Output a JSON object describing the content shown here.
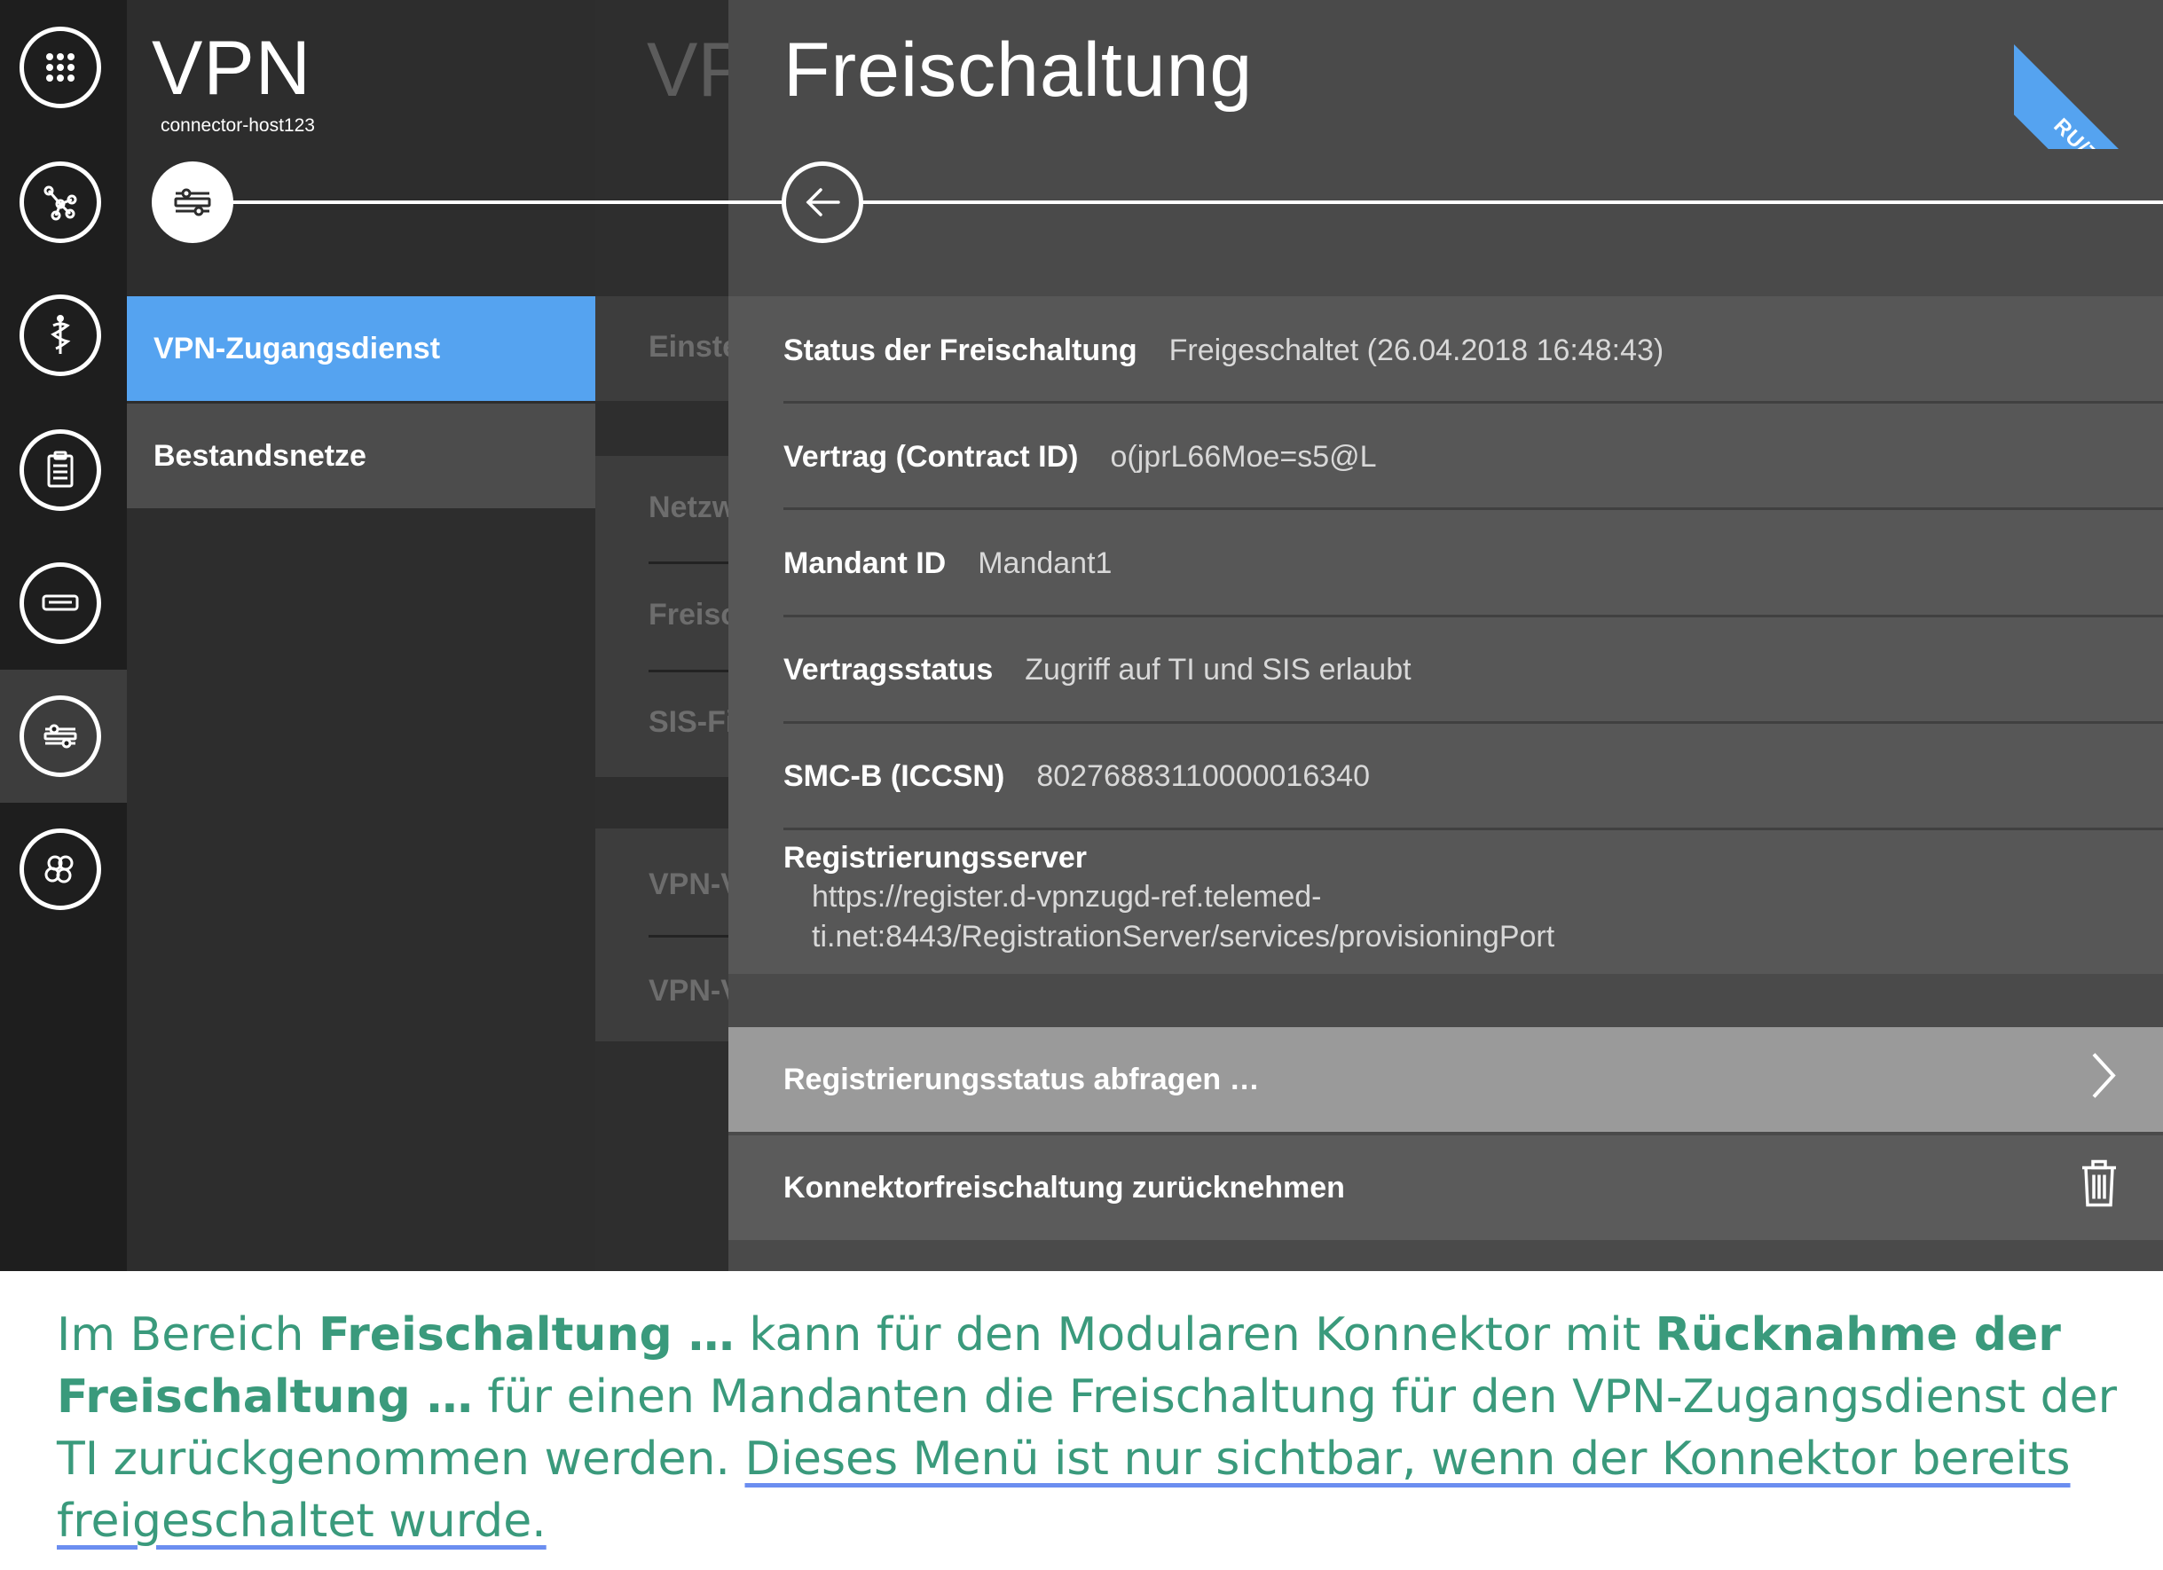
{
  "rail": {
    "icons": [
      "apps-grid-icon",
      "network-graph-icon",
      "medical-caduceus-icon",
      "clipboard-icon",
      "device-card-terminal-icon",
      "vpn-switch-icon",
      "modules-hexagon-icon"
    ],
    "active_index": 5
  },
  "vpn_menu": {
    "title": "VPN",
    "host": "connector-host123",
    "items": [
      {
        "label": "VPN-Zugangsdienst",
        "active": true
      },
      {
        "label": "Bestandsnetze",
        "active": false
      }
    ]
  },
  "background_column": {
    "title": "VP",
    "items": [
      "Einste",
      "Netzw",
      "Freisc",
      "SIS-Fi",
      "VPN-V",
      "VPN-V"
    ]
  },
  "freischaltung": {
    "title": "Freischaltung",
    "corner_badge": "RU/TU",
    "fields": [
      {
        "label": "Status der Freischaltung",
        "value": "Freigeschaltet (26.04.2018 16:48:43)"
      },
      {
        "label": "Vertrag (Contract ID)",
        "value": "o(jprL66Moe=s5@L"
      },
      {
        "label": "Mandant ID",
        "value": "Mandant1"
      },
      {
        "label": "Vertragsstatus",
        "value": "Zugriff auf TI und SIS erlaubt"
      },
      {
        "label": "SMC-B (ICCSN)",
        "value": "80276883110000016340"
      }
    ],
    "registration_server": {
      "label": "Registrierungsserver",
      "value_line1": "https://register.d-vpnzugd-ref.telemed-",
      "value_line2": "ti.net:8443/RegistrationServer/services/provisioningPort"
    },
    "actions": {
      "query_status": "Registrierungsstatus abfragen …",
      "revoke": "Konnektorfreischaltung zurücknehmen"
    }
  },
  "caption": {
    "p1": "Im Bereich ",
    "b1": "Freischaltung …",
    "p2": " kann für den Modularen Konnektor mit ",
    "b2": "Rücknahme der Freischaltung …",
    "p3": " für einen Mandanten die Freischaltung für den VPN-Zugangsdienst der TI zurückgenommen werden. ",
    "underlined": "Dieses Menü ist nur sichtbar, wenn der Konnektor bereits freigeschaltet wurde."
  },
  "colors": {
    "accent_blue": "#55a3f0",
    "caption_green": "#3a9a7c",
    "underline_blue": "#6b8ef0"
  }
}
